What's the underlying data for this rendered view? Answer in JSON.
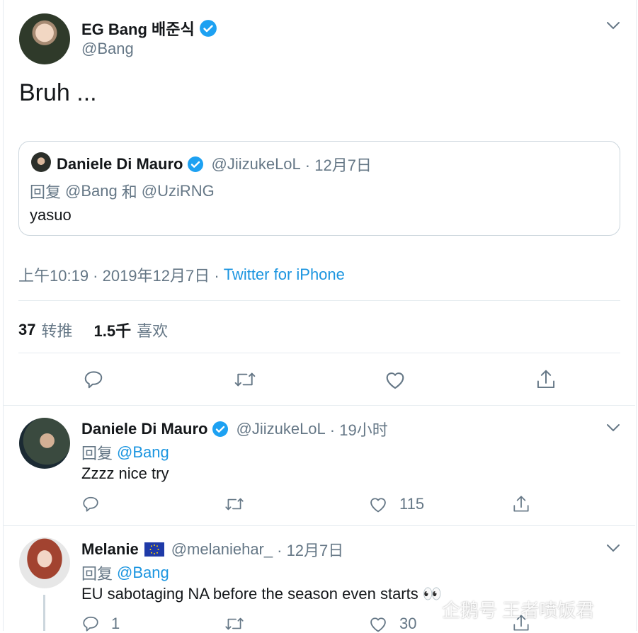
{
  "main_tweet": {
    "author_name": "EG Bang 배준식",
    "author_handle": "@Bang",
    "text": "Bruh ...",
    "quote": {
      "author_name": "Daniele Di Mauro",
      "author_handle": "@JiizukeLoL",
      "date": "· 12月7日",
      "reply_prefix": "回复",
      "reply_to_1": "@Bang",
      "reply_and": "和",
      "reply_to_2": "@UziRNG",
      "text": "yasuo"
    },
    "time": "上午10:19 · 2019年12月7日 ·",
    "source": "Twitter for iPhone",
    "retweet_count": "37",
    "retweet_label": "转推",
    "like_count": "1.5千",
    "like_label": "喜欢"
  },
  "replies": [
    {
      "author_name": "Daniele Di Mauro",
      "author_handle": "@JiizukeLoL",
      "time": "· 19小时",
      "reply_prefix": "回复",
      "reply_to": "@Bang",
      "text": "Zzzz nice try",
      "reply_count": "",
      "like_count": "115"
    },
    {
      "author_name": "Melanie",
      "author_flag": "EU",
      "author_handle": "@melaniehar_",
      "time": "· 12月7日",
      "reply_prefix": "回复",
      "reply_to": "@Bang",
      "text": "EU sabotaging NA before the season even starts 👀",
      "reply_count": "1",
      "like_count": "30"
    }
  ],
  "watermark": "企鹅号 王者喷饭君",
  "colors": {
    "link": "#1b95e0",
    "verified": "#1da1f2",
    "muted": "#657786",
    "divider": "#e6ecf0"
  }
}
